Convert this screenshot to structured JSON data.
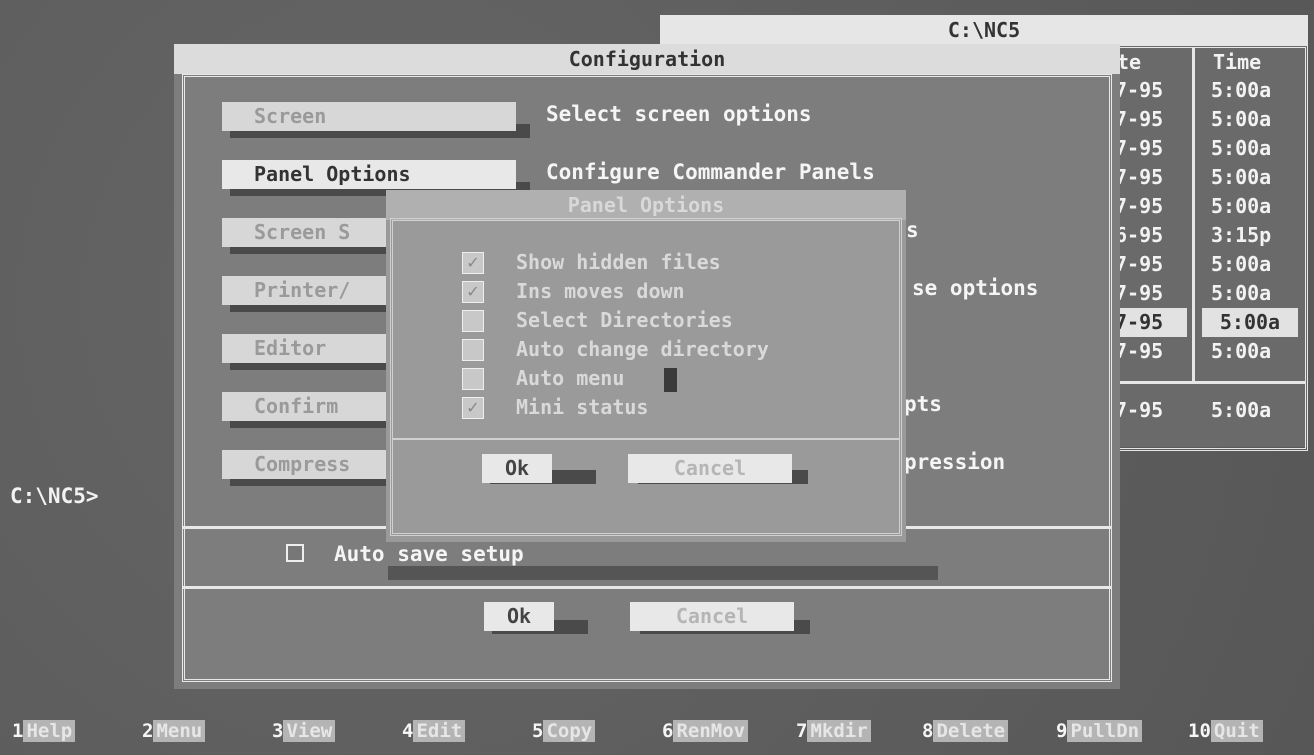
{
  "file_panel": {
    "title": "C:\\NC5",
    "headers": {
      "date": "te",
      "time": "Time"
    },
    "rows": [
      {
        "date": "7-95",
        "time": "5:00a"
      },
      {
        "date": "7-95",
        "time": "5:00a"
      },
      {
        "date": "7-95",
        "time": "5:00a"
      },
      {
        "date": "7-95",
        "time": "5:00a"
      },
      {
        "date": "7-95",
        "time": "5:00a"
      },
      {
        "date": "6-95",
        "time": "3:15p"
      },
      {
        "date": "7-95",
        "time": "5:00a"
      },
      {
        "date": "7-95",
        "time": "5:00a"
      },
      {
        "date": "7-95",
        "time": "5:00a"
      },
      {
        "date": "7-95",
        "time": "5:00a"
      }
    ],
    "footer": {
      "date": "7-95",
      "time": "5:00a"
    }
  },
  "config": {
    "title": "Configuration",
    "buttons": [
      {
        "label": "Screen",
        "desc": "Select screen options"
      },
      {
        "label": "Panel Options",
        "desc": "Configure Commander Panels"
      },
      {
        "label": "Screen S",
        "desc": "s"
      },
      {
        "label": "Printer/",
        "desc": "se options"
      },
      {
        "label": "Editor",
        "desc": ""
      },
      {
        "label": "Confirm",
        "desc": "pts"
      },
      {
        "label": "Compress",
        "desc": "pression"
      }
    ],
    "auto_save_label": "Auto save setup",
    "ok_label": "Ok",
    "cancel_label": "Cancel"
  },
  "panel_options": {
    "title": "Panel Options",
    "options": [
      {
        "label": "Show hidden files",
        "checked": true
      },
      {
        "label": "Ins moves down",
        "checked": true
      },
      {
        "label": "Select Directories",
        "checked": false
      },
      {
        "label": "Auto change directory",
        "checked": false
      },
      {
        "label": "Auto menu",
        "checked": false
      },
      {
        "label": "Mini status",
        "checked": true
      }
    ],
    "ok_label": "Ok",
    "cancel_label": "Cancel"
  },
  "prompt": "C:\\NC5>",
  "fkeys": [
    {
      "num": "1",
      "label": "Help"
    },
    {
      "num": "2",
      "label": "Menu"
    },
    {
      "num": "3",
      "label": "View"
    },
    {
      "num": "4",
      "label": "Edit"
    },
    {
      "num": "5",
      "label": "Copy"
    },
    {
      "num": "6",
      "label": "RenMov"
    },
    {
      "num": "7",
      "label": "Mkdir"
    },
    {
      "num": "8",
      "label": "Delete"
    },
    {
      "num": "9",
      "label": "PullDn"
    },
    {
      "num": "10",
      "label": "Quit"
    }
  ],
  "checkmark_glyph": "✓"
}
